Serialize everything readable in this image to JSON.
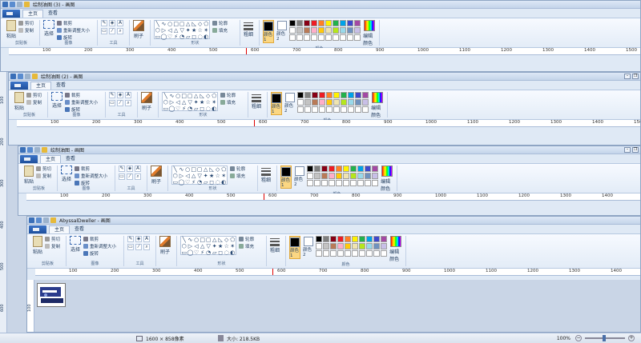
{
  "windows": [
    {
      "title": "绘制油图 (3) - 画图",
      "tab_home": "主页",
      "tab_view": "查看"
    },
    {
      "title": "绘制油图 (2) - 画图",
      "tab_home": "主页",
      "tab_view": "查看"
    },
    {
      "title": "绘制油图 - 画图",
      "tab_home": "主页",
      "tab_view": "查看"
    },
    {
      "title": "AbyssalDweller - 画图",
      "tab_home": "主页",
      "tab_view": "查看"
    }
  ],
  "ribbon": {
    "paste": "粘贴",
    "cut": "剪切",
    "copy": "复制",
    "clipboard": "剪贴板",
    "select": "选择",
    "crop": "裁剪",
    "resize": "重新调整大小",
    "rotate": "旋转",
    "image": "图像",
    "tools": "工具",
    "brushes": "刷子",
    "shapes": "形状",
    "outline": "轮廓",
    "fill": "填充",
    "size": "粗细",
    "color1": "颜色 1",
    "color2": "颜色 2",
    "edit_colors": "编辑颜色",
    "colors": "颜色"
  },
  "ruler_ticks": [
    "100",
    "200",
    "300",
    "400",
    "500",
    "600",
    "700",
    "800",
    "900",
    "1000",
    "1100",
    "1200",
    "1300",
    "1400",
    "1500"
  ],
  "palette": [
    "#000000",
    "#7f7f7f",
    "#880015",
    "#ed1c24",
    "#ff7f27",
    "#fff200",
    "#22b14c",
    "#00a2e8",
    "#3f48cc",
    "#a349a4",
    "#ffffff",
    "#c3c3c3",
    "#b97a57",
    "#ffaec9",
    "#ffc90e",
    "#efe4b0",
    "#b5e61d",
    "#99d9ea",
    "#7092be",
    "#c8bfe7",
    "#ffffff",
    "#ffffff",
    "#ffffff",
    "#ffffff",
    "#ffffff",
    "#ffffff",
    "#ffffff",
    "#ffffff",
    "#ffffff",
    "#ffffff"
  ],
  "status": {
    "dimensions": "1600 × 858像素",
    "size": "大小: 218.5KB",
    "zoom": "100%"
  }
}
